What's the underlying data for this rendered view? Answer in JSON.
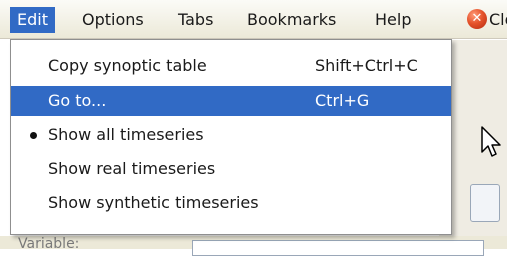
{
  "menubar": {
    "items": [
      {
        "label": "Edit",
        "active": true
      },
      {
        "label": "Options"
      },
      {
        "label": "Tabs"
      },
      {
        "label": "Bookmarks"
      },
      {
        "label": "Help"
      }
    ],
    "close_label": "Clo",
    "close_icon": "close-icon"
  },
  "edit_menu": {
    "items": [
      {
        "label": "Copy synoptic table",
        "shortcut": "Shift+Ctrl+C"
      },
      {
        "label": "Go to...",
        "shortcut": "Ctrl+G",
        "highlighted": true
      },
      {
        "label": "Show all timeseries",
        "checked": true
      },
      {
        "label": "Show real timeseries"
      },
      {
        "label": "Show synthetic timeseries"
      }
    ]
  },
  "background": {
    "variable_label": "Variable:"
  },
  "colors": {
    "highlight": "#316ac5",
    "menubar": "#ece9d8",
    "close_icon": "#e5532b"
  }
}
